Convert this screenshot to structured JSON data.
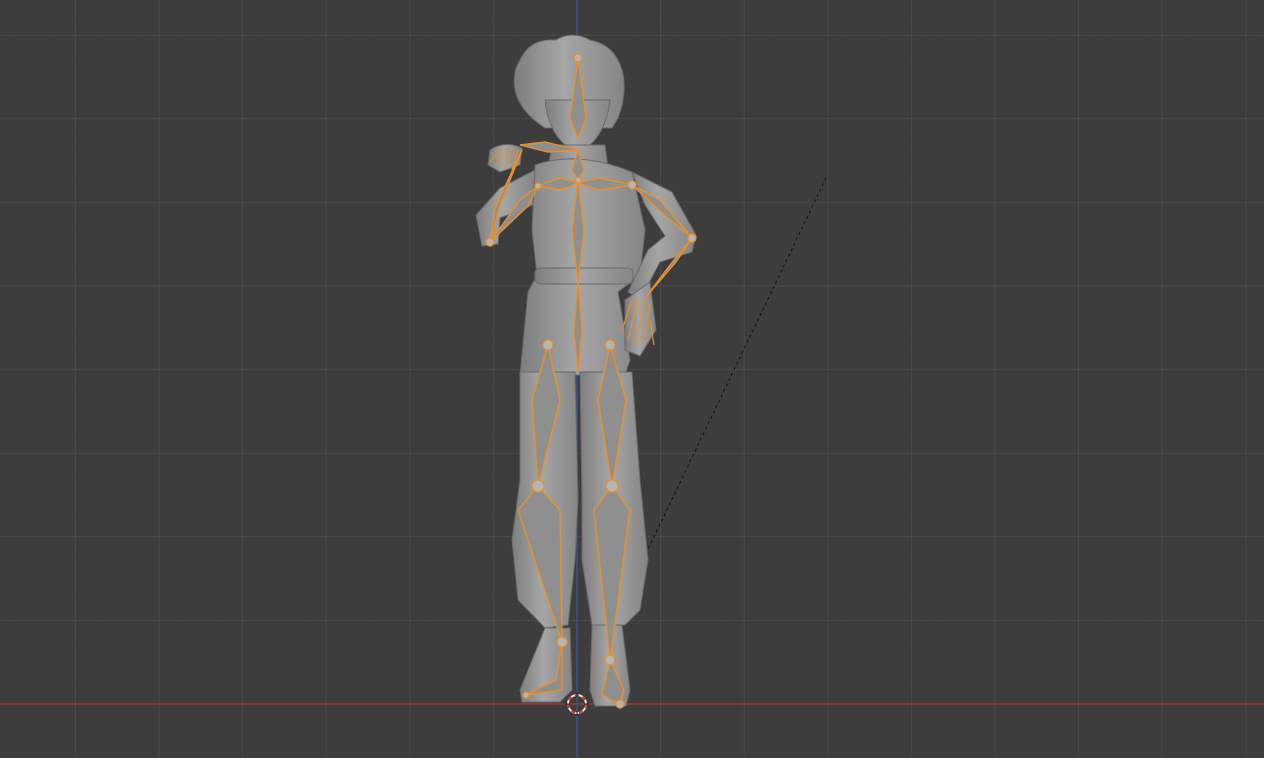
{
  "viewport": {
    "background": "#3d3d3d",
    "grid_minor_color": "#444444",
    "grid_major_color": "#4b4b4b",
    "x_axis_color": "#b33a3a",
    "z_axis_color": "#2e5e9e",
    "selection_color": "#e8902c",
    "mesh_color": "#9c9c9c",
    "cursor_icon": "3d-cursor-icon"
  }
}
